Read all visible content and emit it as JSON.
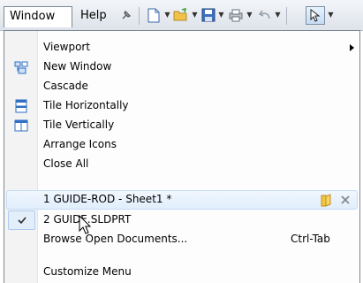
{
  "menubar": {
    "window_label": "Window",
    "help_label": "Help"
  },
  "menu": {
    "items": [
      {
        "label": "Viewport",
        "has_submenu": true
      },
      {
        "label": "New Window",
        "icon": "new-window-icon"
      },
      {
        "label": "Cascade"
      },
      {
        "label": "Tile Horizontally",
        "icon": "tile-horizontal-icon"
      },
      {
        "label": "Tile Vertically",
        "icon": "tile-vertical-icon"
      },
      {
        "label": "Arrange Icons"
      },
      {
        "label": "Close All"
      }
    ],
    "documents": [
      {
        "label": "1 GUIDE-ROD - Sheet1 *",
        "highlighted": true,
        "icons": [
          "folder-icon",
          "close-icon"
        ]
      },
      {
        "label": "2 GUIDE.SLDPRT",
        "checked": true
      }
    ],
    "browse": {
      "label": "Browse Open Documents...",
      "shortcut": "Ctrl-Tab"
    },
    "customize": {
      "label": "Customize Menu"
    }
  },
  "colors": {
    "highlight": "#e0eefc",
    "folder": "#f2c53d",
    "accent_blue": "#2f6fc4"
  }
}
